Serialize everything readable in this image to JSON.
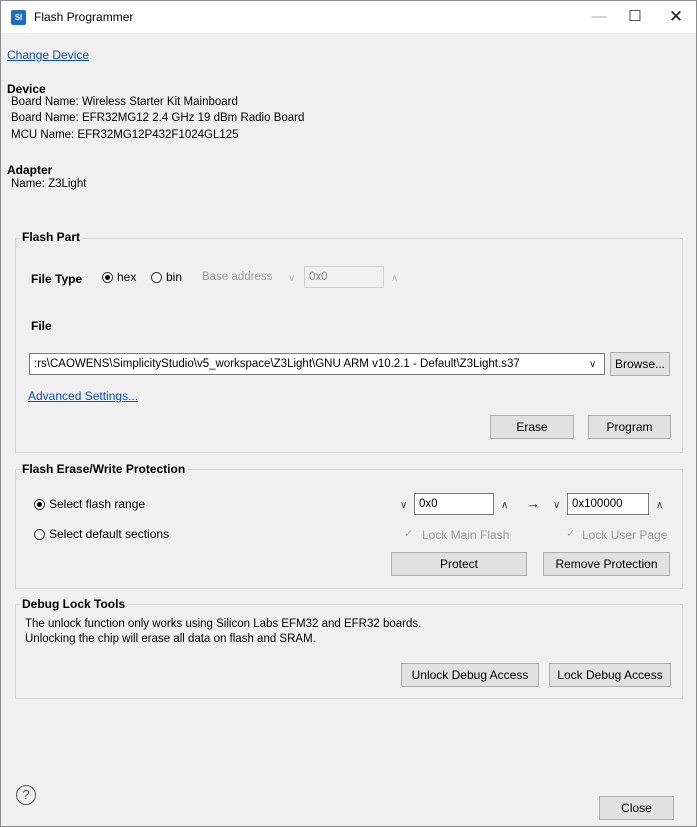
{
  "window": {
    "title": "Flash Programmer",
    "icon_text": "SI",
    "min": "—",
    "max": "☐",
    "close": "✕"
  },
  "change_device": "Change Device",
  "device": {
    "heading": "Device",
    "board1": "Board Name: Wireless Starter Kit Mainboard",
    "board2": "Board Name: EFR32MG12 2.4 GHz 19 dBm Radio Board",
    "mcu": "MCU Name: EFR32MG12P432F1024GL125"
  },
  "adapter": {
    "heading": "Adapter",
    "name": "Name: Z3Light"
  },
  "flash_part": {
    "legend": "Flash Part",
    "file_type_label": "File Type",
    "hex_label": "hex",
    "bin_label": "bin",
    "base_address_label": "Base address",
    "base_address_value": "0x0",
    "file_label": "File",
    "file_path": ":rs\\CAOWENS\\SimplicityStudio\\v5_workspace\\Z3Light\\GNU ARM v10.2.1 - Default\\Z3Light.s37",
    "browse": "Browse...",
    "advanced": "Advanced Settings...",
    "erase": "Erase",
    "program": "Program"
  },
  "protection": {
    "legend": "Flash Erase/Write Protection",
    "select_range": "Select flash range",
    "select_default": "Select default sections",
    "range_start": "0x0",
    "range_end": "0x100000",
    "arrow": "→",
    "lock_main": "Lock Main Flash",
    "lock_user": "Lock User Page",
    "protect": "Protect",
    "remove": "Remove Protection"
  },
  "debug": {
    "legend": "Debug Lock Tools",
    "line1": "The unlock function only works using Silicon Labs EFM32 and EFR32 boards.",
    "line2": "Unlocking the chip will erase all data on flash and SRAM.",
    "unlock": "Unlock Debug Access",
    "lock": "Lock Debug Access"
  },
  "footer": {
    "help": "?",
    "close": "Close"
  },
  "icons": {
    "chevron_down": "∨",
    "chevron_up": "∧",
    "check": "✓"
  }
}
